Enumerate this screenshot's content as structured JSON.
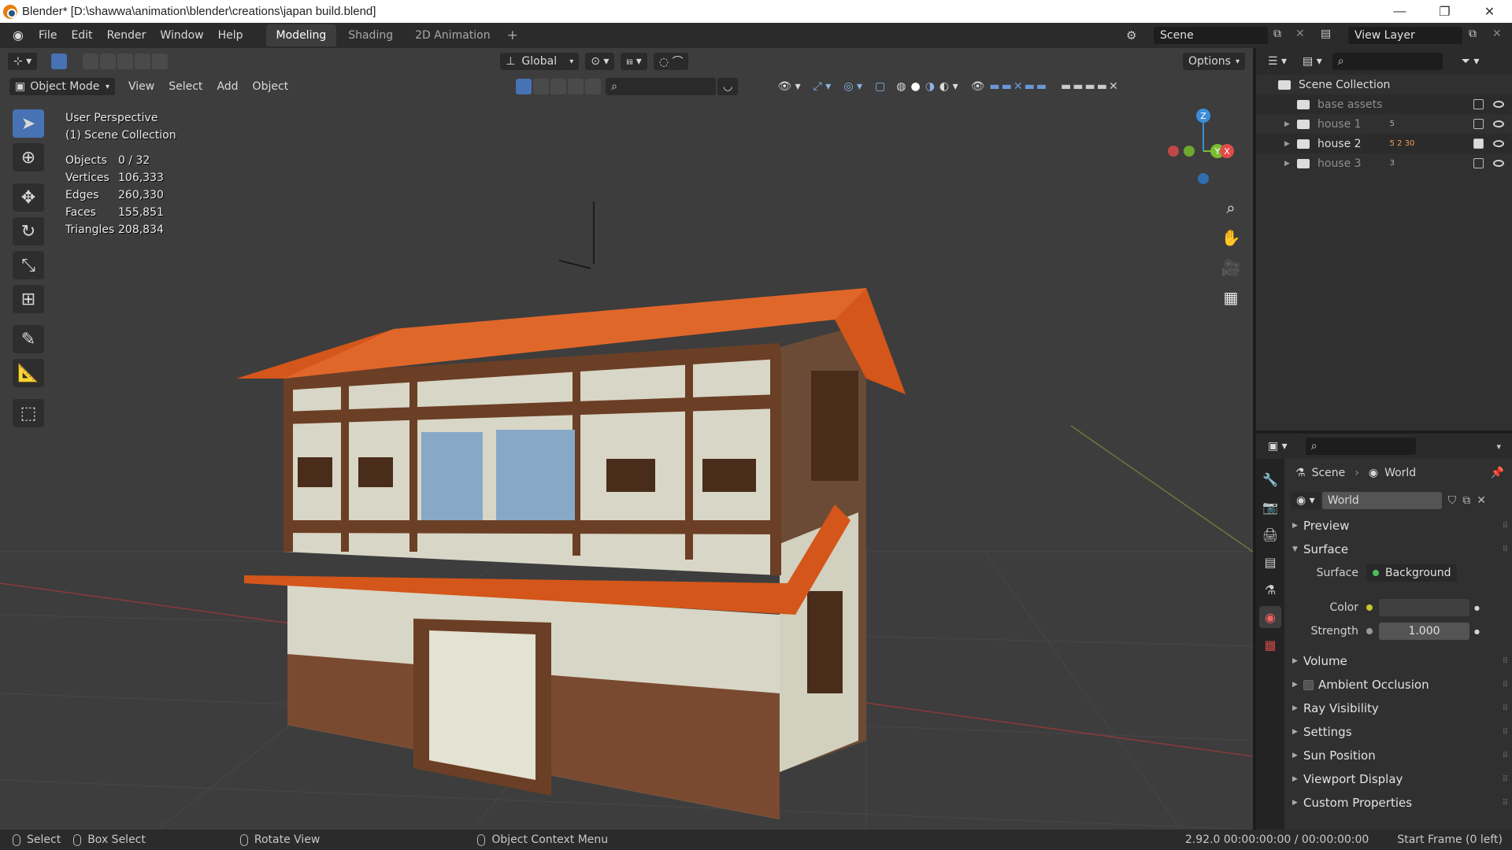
{
  "window": {
    "title": "Blender* [D:\\shawwa\\animation\\blender\\creations\\japan build.blend]",
    "controls": [
      "—",
      "❐",
      "✕"
    ]
  },
  "topbar": {
    "menus": [
      "File",
      "Edit",
      "Render",
      "Window",
      "Help"
    ],
    "workspaces": [
      "Modeling",
      "Shading",
      "2D Animation"
    ],
    "active_workspace": "Modeling",
    "scene": "Scene",
    "view_layer": "View Layer"
  },
  "viewport": {
    "transform_orientation": "Global",
    "options_label": "Options",
    "mode": "Object Mode",
    "menus": [
      "View",
      "Select",
      "Add",
      "Object"
    ],
    "overlay_title": "User Perspective",
    "overlay_collection": "(1) Scene Collection",
    "stats": [
      {
        "label": "Objects",
        "value": "0 / 32"
      },
      {
        "label": "Vertices",
        "value": "106,333"
      },
      {
        "label": "Edges",
        "value": "260,330"
      },
      {
        "label": "Faces",
        "value": "155,851"
      },
      {
        "label": "Triangles",
        "value": "208,834"
      }
    ],
    "gizmo_axes": [
      "Z",
      "Y",
      "X"
    ]
  },
  "tools": [
    {
      "name": "select-box-tool",
      "icon": "cursor-icon",
      "active": true
    },
    {
      "name": "cursor-tool",
      "icon": "crosshair-icon",
      "active": false
    },
    {
      "name": "move-tool",
      "icon": "move-icon",
      "active": false
    },
    {
      "name": "rotate-tool",
      "icon": "rotate-icon",
      "active": false
    },
    {
      "name": "scale-tool",
      "icon": "scale-icon",
      "active": false
    },
    {
      "name": "transform-tool",
      "icon": "transform-icon",
      "active": false
    },
    {
      "name": "annotate-tool",
      "icon": "pencil-icon",
      "active": false
    },
    {
      "name": "measure-tool",
      "icon": "ruler-icon",
      "active": false
    },
    {
      "name": "add-cube-tool",
      "icon": "cube-icon",
      "active": false
    }
  ],
  "outliner": {
    "root": "Scene Collection",
    "items": [
      {
        "label": "base assets",
        "expandable": false,
        "checked": false,
        "dim": true,
        "badges": ""
      },
      {
        "label": "house 1",
        "expandable": true,
        "checked": false,
        "dim": true,
        "badges": "5"
      },
      {
        "label": "house 2",
        "expandable": true,
        "checked": true,
        "dim": false,
        "badges": "5 2 30"
      },
      {
        "label": "house 3",
        "expandable": true,
        "checked": false,
        "dim": true,
        "badges": "3"
      }
    ]
  },
  "properties": {
    "breadcrumb_scene": "Scene",
    "breadcrumb_world": "World",
    "world_name": "World",
    "sections": {
      "preview": "Preview",
      "surface": "Surface",
      "volume": "Volume",
      "ambient_occlusion": "Ambient Occlusion",
      "ray_visibility": "Ray Visibility",
      "settings": "Settings",
      "sun_position": "Sun Position",
      "viewport_display": "Viewport Display",
      "custom_properties": "Custom Properties"
    },
    "surface_label": "Surface",
    "surface_value": "Background",
    "color_label": "Color",
    "strength_label": "Strength",
    "strength_value": "1.000"
  },
  "statusbar": {
    "select": "Select",
    "box_select": "Box Select",
    "rotate_view": "Rotate View",
    "context_menu": "Object Context Menu",
    "version_info": "2.92.0  00:00:00:00 / 00:00:00:00",
    "frame_info": "Start Frame (0 left)"
  },
  "colors": {
    "accent": "#4772b3",
    "roof": "#d4561a",
    "wood": "#6b3f25",
    "plaster": "#d8d6c6",
    "window_blue": "#88a8c8",
    "axis_x": "#e24a4a",
    "axis_y": "#7cbc32",
    "axis_z": "#3b8ddb"
  }
}
